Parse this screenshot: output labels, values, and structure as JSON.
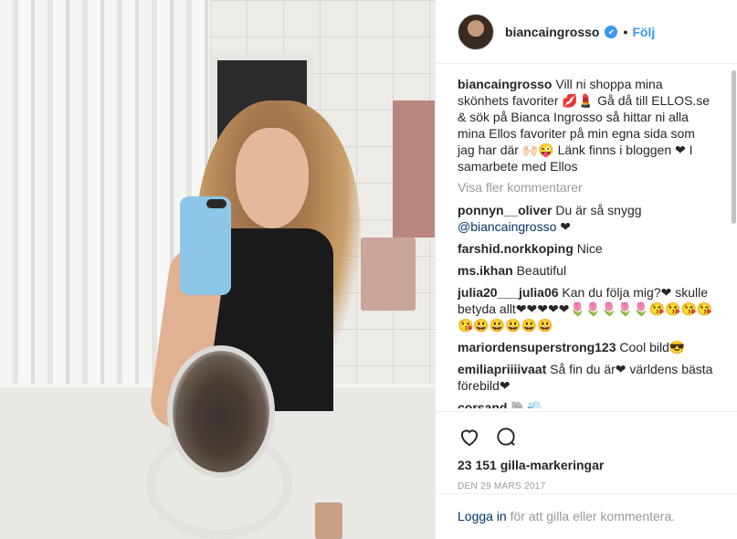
{
  "header": {
    "username": "biancaingrosso",
    "verified_symbol": "✔",
    "separator": "•",
    "follow_label": "Följ"
  },
  "caption": {
    "username": "biancaingrosso",
    "text": "Vill ni shoppa mina skönhets favoriter 💋💄 Gå då till ELLOS.se & sök på Bianca Ingrosso så hittar ni alla mina Ellos favoriter på min egna sida som jag har där 🙌🏻😜 Länk finns i bloggen ❤ I samarbete med Ellos"
  },
  "more_comments_label": "Visa fler kommentarer",
  "comments": [
    {
      "username": "ponnyn__oliver",
      "text": "Du är så snygg ",
      "mention": "@biancaingrosso",
      "suffix": " ❤"
    },
    {
      "username": "farshid.norkkoping",
      "text": "Nice"
    },
    {
      "username": "ms.ikhan",
      "text": "Beautiful"
    },
    {
      "username": "julia20___julia06",
      "text": "Kan du följa mig?❤ skulle betydа allt❤❤❤❤❤🌷🌷🌷🌷🌷😘😘😘😘😘😃😃😃😃😃"
    },
    {
      "username": "mariordensuperstrong123",
      "text": "Cool bild😎"
    },
    {
      "username": "emiliapriiiivaat",
      "text": "Så fin du är❤ världens bästa förebild❤"
    },
    {
      "username": "corsand",
      "text": "🐘💨"
    }
  ],
  "likes_text": "23 151 gilla-markeringar",
  "date_text": "DEN 29 MARS 2017",
  "login": {
    "link_text": "Logga in",
    "rest_text": " för att gilla eller kommentera."
  },
  "icons": {
    "like": "heart-icon",
    "comment": "comment-icon",
    "verified": "verified-badge-icon"
  },
  "colors": {
    "link_blue": "#3897f0",
    "mention_blue": "#003569",
    "muted_gray": "#999999",
    "text": "#262626"
  }
}
